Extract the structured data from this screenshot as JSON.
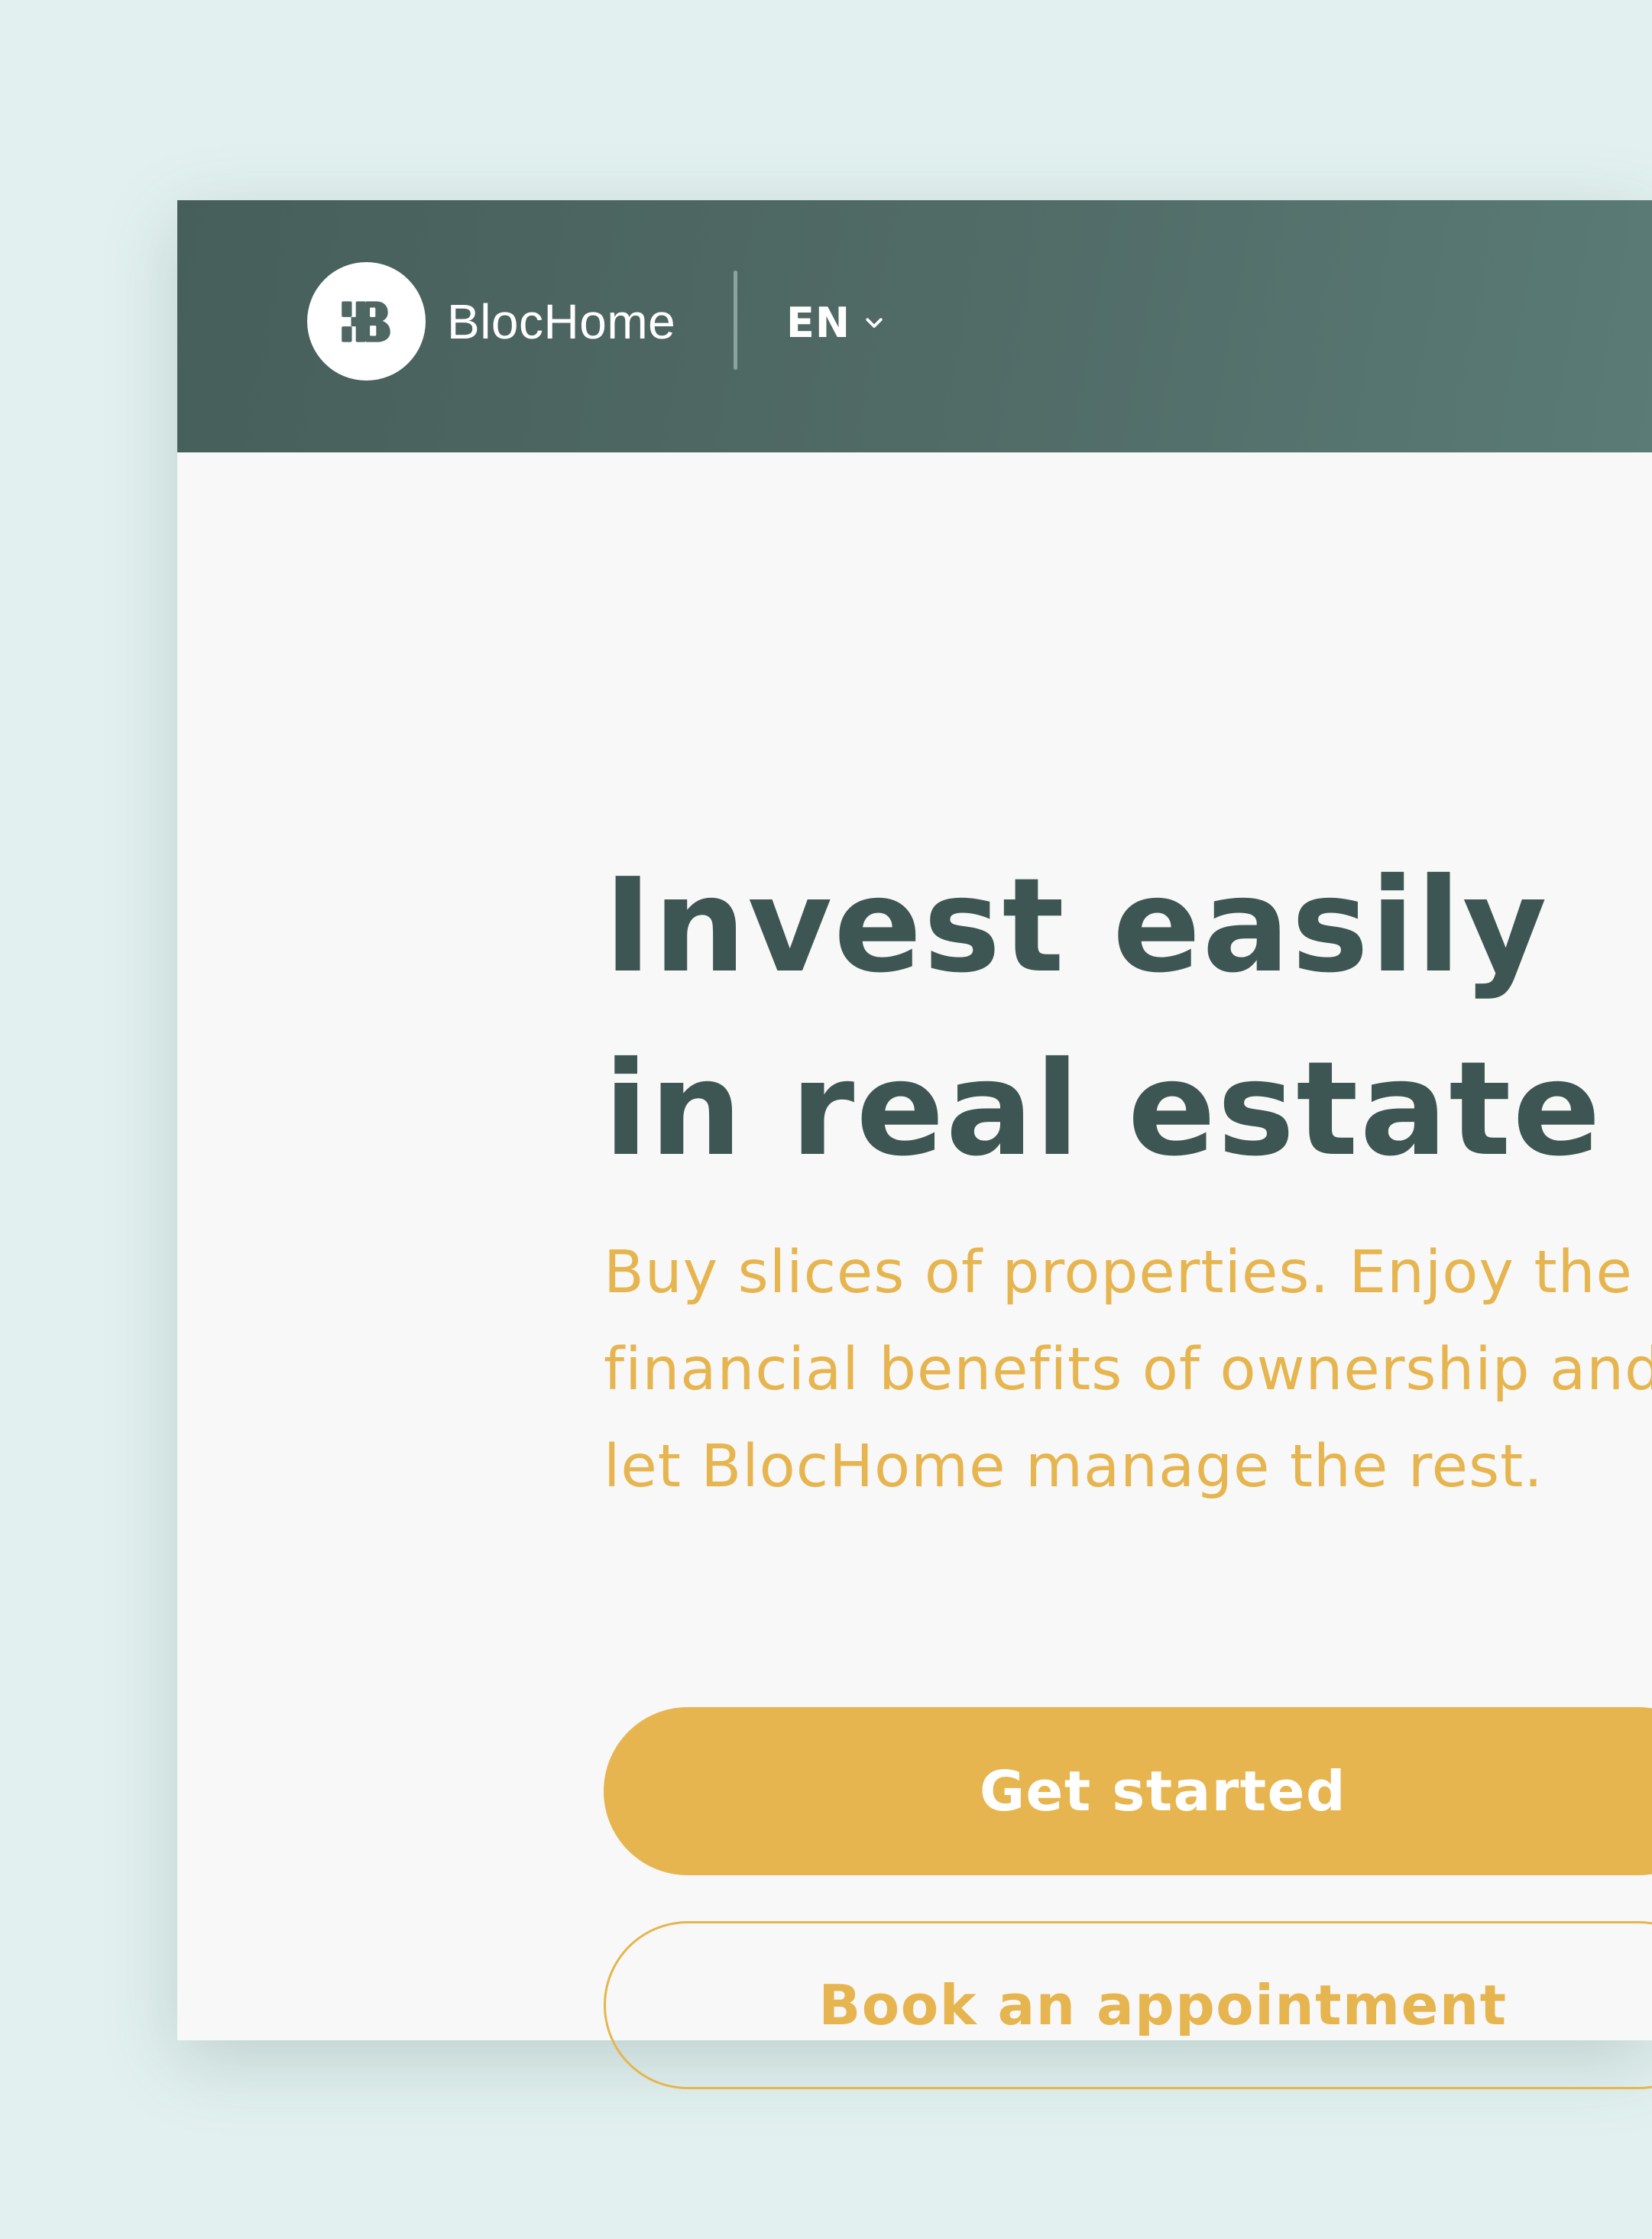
{
  "header": {
    "brand_name": "BlocHome",
    "language": "EN"
  },
  "hero": {
    "headline_line1": "Invest easily",
    "headline_line2": "in real estate",
    "subtext": "Buy slices of properties. Enjoy the financial benefits of ownership and let BlocHome manage the rest."
  },
  "actions": {
    "primary_label": "Get started",
    "secondary_label": "Book an appointment"
  },
  "icons": {
    "logo": "blochome-logo-icon",
    "language_dropdown": "chevron-down-icon"
  },
  "colors": {
    "page_background": "#e2f1f0",
    "header_background": "#4e6763",
    "headline": "#3e5653",
    "accent": "#e6b54f",
    "card_background": "#f8f8f8"
  }
}
